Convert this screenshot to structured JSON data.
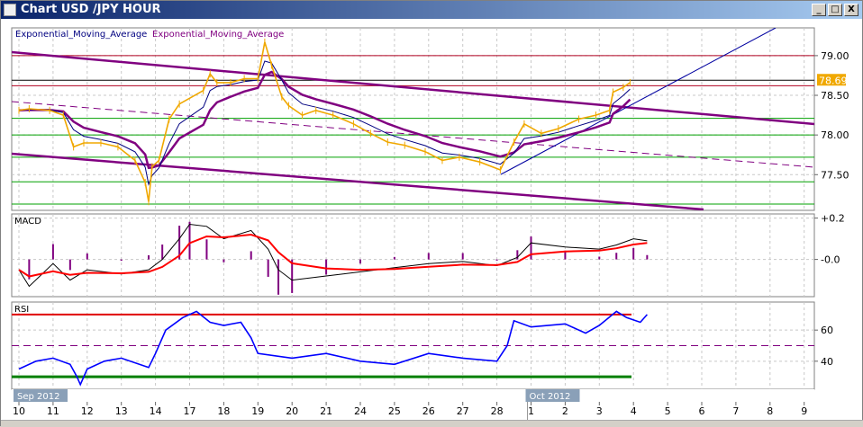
{
  "window": {
    "title": "Chart USD /JPY  HOUR",
    "minimize": "_",
    "maximize": "□",
    "close": "X"
  },
  "legend": {
    "ema1": "Exponential_Moving_Average",
    "ema2": "Exponential_Moving_Average"
  },
  "colors": {
    "price": "#f0a800",
    "ema_fast": "#000080",
    "ema_slow": "#800080",
    "channel": "#800080",
    "level_red": "#b00020",
    "level_green": "#00a000",
    "rsi": "#0000ff",
    "macd_signal": "#ff0000"
  },
  "chart_data": [
    {
      "type": "line",
      "title": "USD/JPY HOUR",
      "ylim": [
        77.05,
        79.35
      ],
      "y_ticks": [
        "79.00",
        "78.50",
        "78.00",
        "77.50"
      ],
      "y_tick_values": [
        79.0,
        78.5,
        78.0,
        77.5
      ],
      "last_price_label": "78.69",
      "last_price": 78.69,
      "x_ticks": [
        "10",
        "11",
        "12",
        "13",
        "14",
        "17",
        "18",
        "19",
        "20",
        "21",
        "24",
        "25",
        "26",
        "27",
        "28",
        "1",
        "2",
        "3",
        "4",
        "5",
        "6",
        "7",
        "8",
        "9"
      ],
      "month_labels": [
        {
          "label": "Sep 2012",
          "day": 0
        },
        {
          "label": "Oct 2012",
          "day": 15
        }
      ],
      "levels_red": [
        79.0,
        78.62
      ],
      "levels_black": [
        78.69
      ],
      "levels_green": [
        78.21,
        78.0,
        77.72,
        77.41,
        77.13
      ],
      "price": [
        [
          0,
          78.31
        ],
        [
          0.3,
          78.33
        ],
        [
          0.9,
          78.31
        ],
        [
          1.3,
          78.25
        ],
        [
          1.6,
          77.85
        ],
        [
          1.9,
          77.9
        ],
        [
          2.4,
          77.9
        ],
        [
          2.9,
          77.85
        ],
        [
          3.4,
          77.68
        ],
        [
          3.7,
          77.4
        ],
        [
          3.8,
          77.16
        ],
        [
          3.9,
          77.6
        ],
        [
          4.1,
          77.68
        ],
        [
          4.4,
          78.2
        ],
        [
          4.7,
          78.39
        ],
        [
          5.4,
          78.56
        ],
        [
          5.6,
          78.77
        ],
        [
          5.8,
          78.66
        ],
        [
          6.2,
          78.66
        ],
        [
          6.6,
          78.71
        ],
        [
          7.0,
          78.71
        ],
        [
          7.2,
          79.17
        ],
        [
          7.4,
          78.88
        ],
        [
          7.7,
          78.48
        ],
        [
          7.9,
          78.37
        ],
        [
          8.3,
          78.25
        ],
        [
          8.7,
          78.31
        ],
        [
          9.2,
          78.25
        ],
        [
          9.8,
          78.14
        ],
        [
          10.3,
          78.02
        ],
        [
          10.8,
          77.91
        ],
        [
          11.3,
          77.87
        ],
        [
          11.9,
          77.79
        ],
        [
          12.4,
          77.68
        ],
        [
          12.9,
          77.72
        ],
        [
          13.5,
          77.66
        ],
        [
          14.1,
          77.56
        ],
        [
          14.5,
          77.91
        ],
        [
          14.8,
          78.14
        ],
        [
          15.3,
          78.02
        ],
        [
          15.8,
          78.08
        ],
        [
          16.4,
          78.2
        ],
        [
          16.9,
          78.25
        ],
        [
          17.3,
          78.31
        ],
        [
          17.4,
          78.54
        ],
        [
          17.7,
          78.6
        ],
        [
          17.9,
          78.66
        ]
      ]
    },
    {
      "type": "line",
      "title": "MACD",
      "ylim": [
        -0.18,
        0.22
      ],
      "y_ticks": [
        "+0.2",
        "-0.0"
      ],
      "y_tick_values": [
        0.2,
        0.0
      ],
      "macd": [
        [
          0,
          -0.05
        ],
        [
          0.3,
          -0.13
        ],
        [
          1,
          -0.02
        ],
        [
          1.5,
          -0.1
        ],
        [
          2,
          -0.05
        ],
        [
          3,
          -0.07
        ],
        [
          3.8,
          -0.05
        ],
        [
          4.2,
          0.0
        ],
        [
          4.7,
          0.1
        ],
        [
          5,
          0.17
        ],
        [
          5.5,
          0.16
        ],
        [
          6,
          0.1
        ],
        [
          6.8,
          0.14
        ],
        [
          7.3,
          0.05
        ],
        [
          7.6,
          -0.05
        ],
        [
          8,
          -0.1
        ],
        [
          9,
          -0.08
        ],
        [
          10,
          -0.06
        ],
        [
          11,
          -0.04
        ],
        [
          12,
          -0.02
        ],
        [
          13,
          -0.01
        ],
        [
          14,
          -0.03
        ],
        [
          14.6,
          0.01
        ],
        [
          15,
          0.08
        ],
        [
          16,
          0.06
        ],
        [
          17,
          0.05
        ],
        [
          17.5,
          0.07
        ],
        [
          18,
          0.1
        ],
        [
          18.4,
          0.09
        ]
      ]
    },
    {
      "type": "line",
      "title": "RSI",
      "ylim": [
        22,
        78
      ],
      "y_ticks": [
        "60",
        "40"
      ],
      "y_tick_values": [
        60,
        40
      ],
      "levels": [
        70,
        50,
        30
      ],
      "rsi": [
        [
          0,
          35
        ],
        [
          0.5,
          40
        ],
        [
          1,
          42
        ],
        [
          1.5,
          38
        ],
        [
          1.7,
          30
        ],
        [
          1.8,
          25
        ],
        [
          2,
          35
        ],
        [
          2.5,
          40
        ],
        [
          3,
          42
        ],
        [
          3.8,
          36
        ],
        [
          4,
          45
        ],
        [
          4.3,
          60
        ],
        [
          4.8,
          68
        ],
        [
          5.2,
          72
        ],
        [
          5.6,
          65
        ],
        [
          6,
          63
        ],
        [
          6.5,
          65
        ],
        [
          6.8,
          55
        ],
        [
          7,
          45
        ],
        [
          8,
          42
        ],
        [
          9,
          45
        ],
        [
          10,
          40
        ],
        [
          11,
          38
        ],
        [
          12,
          45
        ],
        [
          13,
          42
        ],
        [
          14,
          40
        ],
        [
          14.3,
          50
        ],
        [
          14.5,
          66
        ],
        [
          15,
          62
        ],
        [
          16,
          64
        ],
        [
          16.6,
          58
        ],
        [
          17,
          63
        ],
        [
          17.5,
          72
        ],
        [
          17.8,
          68
        ],
        [
          18.2,
          65
        ],
        [
          18.4,
          70
        ]
      ]
    }
  ]
}
